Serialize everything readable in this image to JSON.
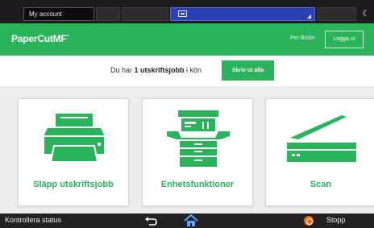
{
  "topbar": {
    "account_tab": "My account"
  },
  "header": {
    "logo_text": "PaperCut",
    "logo_suffix": "MF",
    "user_name": "Per Brolin",
    "logout_label": "Logga ut"
  },
  "info": {
    "message_prefix": "Du har ",
    "message_bold": "1 utskriftsjobb",
    "message_suffix": " i kön",
    "print_all_label": "Skriv ut alla"
  },
  "tiles": [
    {
      "label": "Släpp utskriftsjobb",
      "icon": "printer-icon"
    },
    {
      "label": "Enhetsfunktioner",
      "icon": "copier-icon"
    },
    {
      "label": "Scan",
      "icon": "scanner-icon"
    }
  ],
  "bottombar": {
    "status_label": "Kontrollera status",
    "stop_label": "Stopp"
  },
  "colors": {
    "brand_green": "#2ab35b",
    "stop_orange": "#ec6a1c",
    "topbar_blue": "#2d3fb4"
  }
}
